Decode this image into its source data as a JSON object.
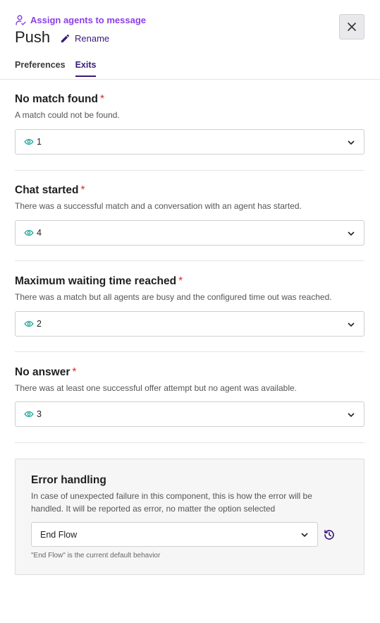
{
  "header": {
    "assign_link": "Assign agents to message",
    "title": "Push",
    "rename_label": "Rename"
  },
  "tabs": [
    {
      "label": "Preferences",
      "active": false
    },
    {
      "label": "Exits",
      "active": true
    }
  ],
  "exits": [
    {
      "title": "No match found",
      "required_mark": "*",
      "description": "A match could not be found.",
      "value": "1"
    },
    {
      "title": "Chat started",
      "required_mark": "*",
      "description": "There was a successful match and a conversation with an agent has started.",
      "value": "4"
    },
    {
      "title": "Maximum waiting time reached",
      "required_mark": "*",
      "description": "There was a match but all agents are busy and the configured time out was reached.",
      "value": "2"
    },
    {
      "title": "No answer",
      "required_mark": "*",
      "description": "There was at least one successful offer attempt but no agent was available.",
      "value": "3"
    }
  ],
  "error_handling": {
    "title": "Error handling",
    "description": "In case of unexpected failure in this component, this is how the error will be handled. It will be reported as error, no matter the option selected",
    "selected": "End Flow",
    "hint": "\"End Flow\" is the current default behavior"
  },
  "colors": {
    "accent_purple": "#8b3fe6",
    "dark_purple": "#3a1a7a",
    "required_red": "#d93025",
    "eye_teal": "#1aa39a"
  },
  "icons": {
    "assign": "assign-agents-icon",
    "rename": "pencil-icon",
    "close": "close-icon",
    "value": "eye-icon",
    "dropdown": "chevron-down-icon",
    "reset": "reset-history-icon"
  }
}
